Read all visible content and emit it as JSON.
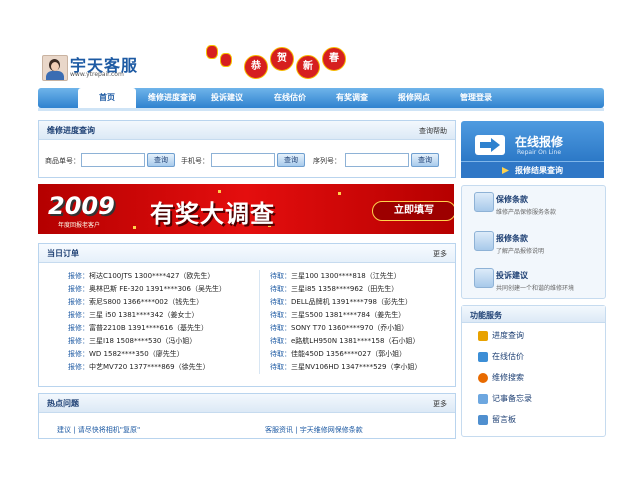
{
  "header": {
    "site_title": "宇天客服",
    "url": "www.ytrepair.com",
    "newyear_chars": [
      "恭",
      "贺",
      "新",
      "春"
    ]
  },
  "nav": {
    "items": [
      "首页",
      "维修进度查询",
      "投诉建议",
      "在线估价",
      "有奖调查",
      "报修网点",
      "管理登录"
    ]
  },
  "query": {
    "title": "维修进度查询",
    "help": "查询帮助",
    "fields": [
      {
        "label": "商品单号：",
        "button": "查询"
      },
      {
        "label": "手机号：",
        "button": "查询"
      },
      {
        "label": "序列号：",
        "button": "查询"
      }
    ]
  },
  "banner": {
    "year": "2009",
    "sub": "年度回报老客户",
    "headline": "有奖大调查",
    "cta": "立即填写"
  },
  "orders": {
    "title": "当日订单",
    "more": "更多",
    "left": [
      {
        "lbl": "报修：",
        "text": "柯达C100JTS  1300****427（欧先生）"
      },
      {
        "lbl": "报修：",
        "text": "奥林巴斯 FE-320   1391****306（吴先生）"
      },
      {
        "lbl": "报修：",
        "text": "索尼S800    1366****002（钱先生）"
      },
      {
        "lbl": "报修：",
        "text": "三星 i50   1381****342（姜女士）"
      },
      {
        "lbl": "报修：",
        "text": "富普2210B    1391****616（基先生）"
      },
      {
        "lbl": "报修：",
        "text": "三星I18    1508****530（冯小姐）"
      },
      {
        "lbl": "报修：",
        "text": "WD    1582****350（廖先生）"
      },
      {
        "lbl": "报修：",
        "text": "中艺MV720    1377****869（徐先生）"
      }
    ],
    "right": [
      {
        "lbl": "待取：",
        "text": "三星100   1300****818（江先生）"
      },
      {
        "lbl": "待取：",
        "text": "三星i85    1358****962（田先生）"
      },
      {
        "lbl": "待取：",
        "text": "DELL品牌机    1391****798（彭先生）"
      },
      {
        "lbl": "待取：",
        "text": "三星S500    1381****784（姜先生）"
      },
      {
        "lbl": "待取：",
        "text": "SONY T70    1360****970（乔小姐）"
      },
      {
        "lbl": "待取：",
        "text": "e路航LH950N    1381****158（石小姐）"
      },
      {
        "lbl": "待取：",
        "text": "佳能450D    1356****027（郭小姐）"
      },
      {
        "lbl": "待取：",
        "text": "三星NV106HD    1347****529（李小姐）"
      }
    ]
  },
  "hot": {
    "title": "热点问题",
    "more": "更多",
    "left_item": "建议 | 请尽快将相机\"复原\"",
    "right_item": "客服资讯 | 宇天维修网保修条款"
  },
  "online": {
    "title": "在线报修",
    "en": "Repair On Line",
    "foot": "报修结果查询"
  },
  "services": [
    {
      "title": "保修条款",
      "desc": "维修产品保修服务条款"
    },
    {
      "title": "报修条款",
      "desc": "了解产品报修说明"
    },
    {
      "title": "投诉建议",
      "desc": "共同创建一个和谐的维修环境"
    }
  ],
  "functions": {
    "title": "功能服务",
    "items": [
      {
        "label": "进度查询",
        "color": "#e8a200"
      },
      {
        "label": "在线估价",
        "color": "#3c8ed6"
      },
      {
        "label": "维修搜索",
        "color": "#e86a00"
      },
      {
        "label": "记事备忘录",
        "color": "#6da7e0"
      },
      {
        "label": "留言板",
        "color": "#4f8fcf"
      }
    ]
  }
}
